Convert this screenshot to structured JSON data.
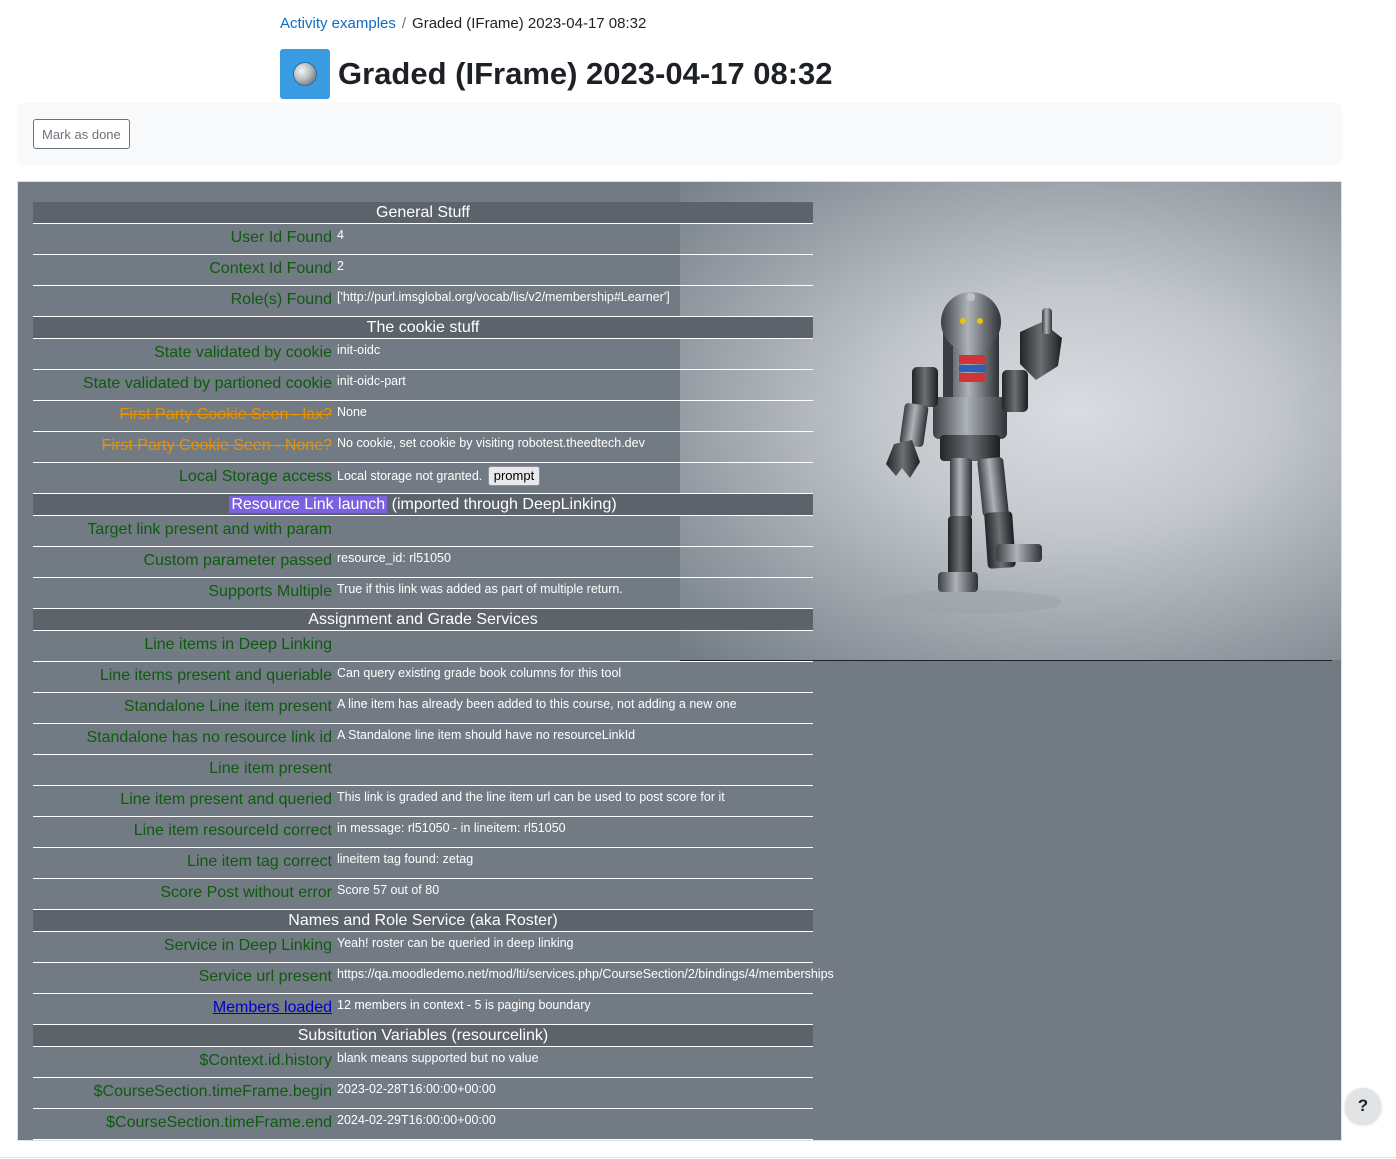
{
  "breadcrumb": {
    "parent": "Activity examples",
    "separator": "/",
    "current": "Graded (IFrame) 2023-04-17 08:32"
  },
  "page": {
    "title": "Graded (IFrame) 2023-04-17 08:32",
    "activity_icon": "lti-activity-icon"
  },
  "completion": {
    "mark_done_label": "Mark as done"
  },
  "tool": {
    "sections": {
      "general": "General Stuff",
      "cookie": "The cookie stuff",
      "resource_link_highlight": "Resource Link launch",
      "resource_link_rest": " (imported through DeepLinking)",
      "ags": "Assignment and Grade Services",
      "nrps": "Names and Role Service (aka Roster)",
      "subst": "Subsitution Variables (resourcelink)"
    },
    "general_rows": [
      {
        "key": "User Id Found",
        "value": "4"
      },
      {
        "key": "Context Id Found",
        "value": "2"
      },
      {
        "key": "Role(s) Found",
        "value": "['http://purl.imsglobal.org/vocab/lis/v2/membership#Learner']"
      }
    ],
    "cookie_rows": [
      {
        "key": "State validated by cookie",
        "value": "init-oidc"
      },
      {
        "key": "State validated by partioned cookie",
        "value": "init-oidc-part"
      },
      {
        "key": "First Party Cookie Seen - lax?",
        "value": "None"
      },
      {
        "key": "First Party Cookie Seen - None?",
        "value": "No cookie, set cookie by visiting robotest.theedtech.dev"
      }
    ],
    "local_storage": {
      "key": "Local Storage access",
      "value": "Local storage not granted.",
      "button": "prompt"
    },
    "resource_rows": [
      {
        "key": "Target link present and with param",
        "value": ""
      },
      {
        "key": "Custom parameter passed",
        "value": "resource_id: rl51050"
      },
      {
        "key": "Supports Multiple",
        "value": "True if this link was added as part of multiple return."
      }
    ],
    "ags_rows": [
      {
        "key": "Line items in Deep Linking",
        "value": ""
      },
      {
        "key": "Line items present and queriable",
        "value": "Can query existing grade book columns for this tool"
      },
      {
        "key": "Standalone Line item present",
        "value": "A line item has already been added to this course, not adding a new one"
      },
      {
        "key": "Standalone has no resource link id",
        "value": "A Standalone line item should have no resourceLinkId"
      },
      {
        "key": "Line item present",
        "value": ""
      },
      {
        "key": "Line item present and queried",
        "value": "This link is graded and the line item url can be used to post score for it"
      },
      {
        "key": "Line item resourceId correct",
        "value": "in message: rl51050 - in lineitem: rl51050"
      },
      {
        "key": "Line item tag correct",
        "value": "lineitem tag found: zetag"
      },
      {
        "key": "Score Post without error",
        "value": "Score 57 out of 80"
      }
    ],
    "nrps_rows": [
      {
        "key": "Service in Deep Linking",
        "value": "Yeah! roster can be queried in deep linking"
      },
      {
        "key": "Service url present",
        "value": "https://qa.moodledemo.net/mod/lti/services.php/CourseSection/2/bindings/4/memberships"
      }
    ],
    "members": {
      "key": "Members loaded",
      "value": "12 members in context - 5 is paging boundary"
    },
    "subst_rows": [
      {
        "key": "$Context.id.history",
        "value": "blank means supported but no value"
      },
      {
        "key": "$CourseSection.timeFrame.begin",
        "value": "2023-02-28T16:00:00+00:00"
      },
      {
        "key": "$CourseSection.timeFrame.end",
        "value": "2024-02-29T16:00:00+00:00"
      }
    ]
  },
  "help": {
    "label": "?"
  },
  "colors": {
    "link": "#0f6cbf",
    "iframe_bg": "#727b84",
    "section_bg": "#5c636a",
    "key_green": "#0e5a0e",
    "strike_orange": "#e69100",
    "highlight_purple": "#7b62e0"
  }
}
